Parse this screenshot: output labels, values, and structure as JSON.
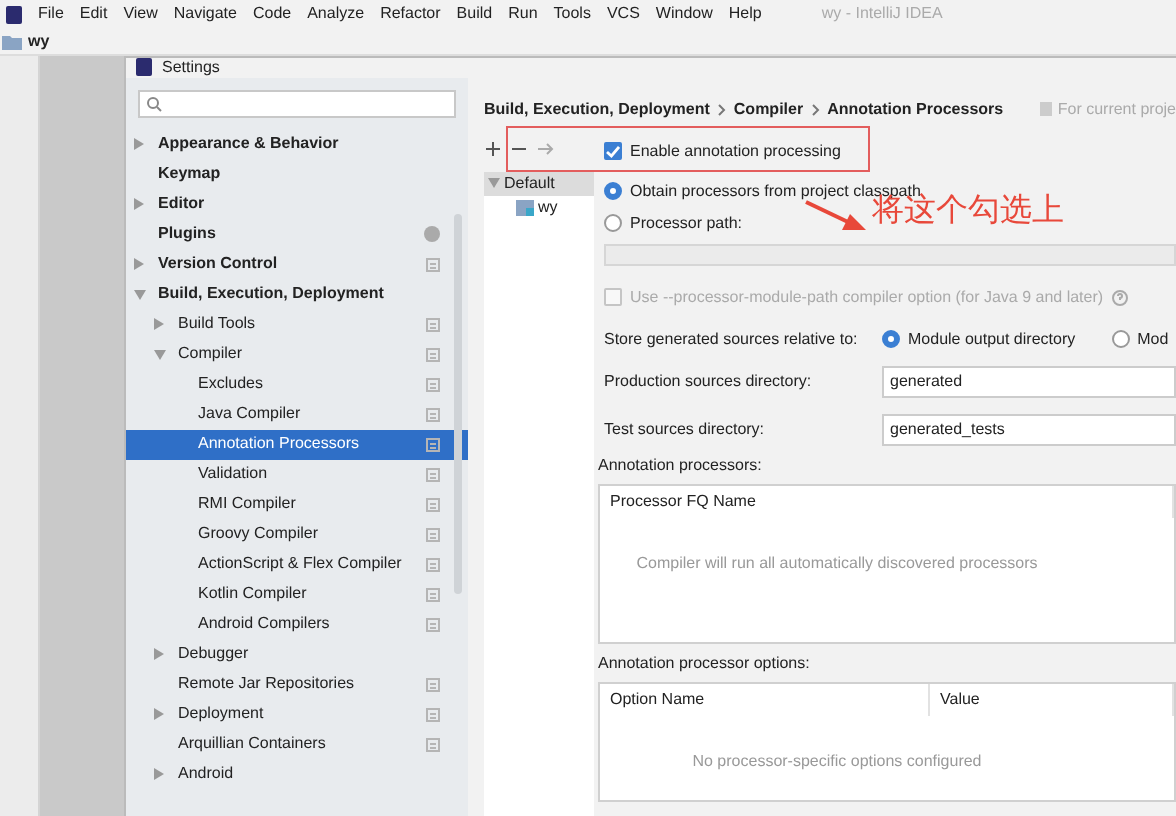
{
  "menu_bar": {
    "items": [
      "File",
      "Edit",
      "View",
      "Navigate",
      "Code",
      "Analyze",
      "Refactor",
      "Build",
      "Run",
      "Tools",
      "VCS",
      "Window",
      "Help"
    ],
    "title": "wy - IntelliJ IDEA"
  },
  "navigation_bar": {
    "project": "wy"
  },
  "dialog": {
    "title": "Settings"
  },
  "sidebar": {
    "items": [
      {
        "label": "Appearance & Behavior",
        "expanded": false,
        "project_level": false,
        "badge": false,
        "selected": false
      },
      {
        "label": "Keymap",
        "project_level": false,
        "badge": false,
        "selected": false
      },
      {
        "label": "Editor",
        "expanded": false,
        "project_level": false,
        "badge": false,
        "selected": false
      },
      {
        "label": "Plugins",
        "project_level": false,
        "badge": true,
        "selected": false
      },
      {
        "label": "Version Control",
        "expanded": false,
        "project_level": true,
        "badge": false,
        "selected": false
      },
      {
        "label": "Build, Execution, Deployment",
        "expanded": true,
        "project_level": false,
        "badge": false,
        "selected": false,
        "children": [
          {
            "label": "Build Tools",
            "expanded": false,
            "project_level": true,
            "badge": false,
            "selected": false
          },
          {
            "label": "Compiler",
            "expanded": true,
            "project_level": true,
            "badge": false,
            "selected": false,
            "children": [
              {
                "label": "Excludes",
                "project_level": true,
                "badge": false,
                "selected": false
              },
              {
                "label": "Java Compiler",
                "project_level": true,
                "badge": false,
                "selected": false
              },
              {
                "label": "Annotation Processors",
                "project_level": true,
                "badge": false,
                "selected": true
              },
              {
                "label": "Validation",
                "project_level": true,
                "badge": false,
                "selected": false
              },
              {
                "label": "RMI Compiler",
                "project_level": true,
                "badge": false,
                "selected": false
              },
              {
                "label": "Groovy Compiler",
                "project_level": true,
                "badge": false,
                "selected": false
              },
              {
                "label": "ActionScript & Flex Compiler",
                "project_level": true,
                "badge": false,
                "selected": false
              },
              {
                "label": "Kotlin Compiler",
                "project_level": true,
                "badge": false,
                "selected": false
              },
              {
                "label": "Android Compilers",
                "project_level": true,
                "badge": false,
                "selected": false
              }
            ]
          },
          {
            "label": "Debugger",
            "expanded": false,
            "project_level": false,
            "badge": false,
            "selected": false
          },
          {
            "label": "Remote Jar Repositories",
            "project_level": true,
            "badge": false,
            "selected": false
          },
          {
            "label": "Deployment",
            "expanded": false,
            "project_level": true,
            "badge": false,
            "selected": false
          },
          {
            "label": "Arquillian Containers",
            "project_level": true,
            "badge": false,
            "selected": false
          },
          {
            "label": "Android",
            "expanded": false,
            "project_level": false,
            "badge": false,
            "selected": false
          }
        ]
      }
    ]
  },
  "breadcrumb": [
    "Build, Execution, Deployment",
    "Compiler",
    "Annotation Processors"
  ],
  "scope_label": "For current proje",
  "profiles": [
    {
      "label": "Default",
      "expanded": true,
      "selected": true,
      "children": [
        {
          "label": "wy",
          "selected": false
        }
      ]
    }
  ],
  "enable_processing": {
    "label": "Enable annotation processing",
    "checked": true
  },
  "processor_source": [
    {
      "label": "Obtain processors from project classpath",
      "selected": true
    },
    {
      "label": "Processor path:",
      "selected": false
    }
  ],
  "processor_path_field": {
    "disabled": true
  },
  "module_path_option": {
    "label": "Use --processor-module-path compiler option (for Java 9 and later)",
    "checked": false,
    "disabled": true
  },
  "store_relative": {
    "label": "Store generated sources relative to:",
    "options": [
      {
        "label": "Module output directory",
        "selected": true
      },
      {
        "label": "Mod",
        "selected": false
      }
    ]
  },
  "fields": [
    {
      "label": "Production sources directory:",
      "value": "generated"
    },
    {
      "label": "Test sources directory:",
      "value": "generated_tests"
    }
  ],
  "processors_table": {
    "title": "Annotation processors:",
    "columns": [
      "Processor FQ Name"
    ],
    "empty_text": "Compiler will run all automatically discovered processors"
  },
  "options_table": {
    "title": "Annotation processor options:",
    "columns": [
      "Option Name",
      "Value"
    ],
    "empty_text": "No processor-specific options configured"
  },
  "annotation": {
    "text": "将这个勾选上"
  }
}
